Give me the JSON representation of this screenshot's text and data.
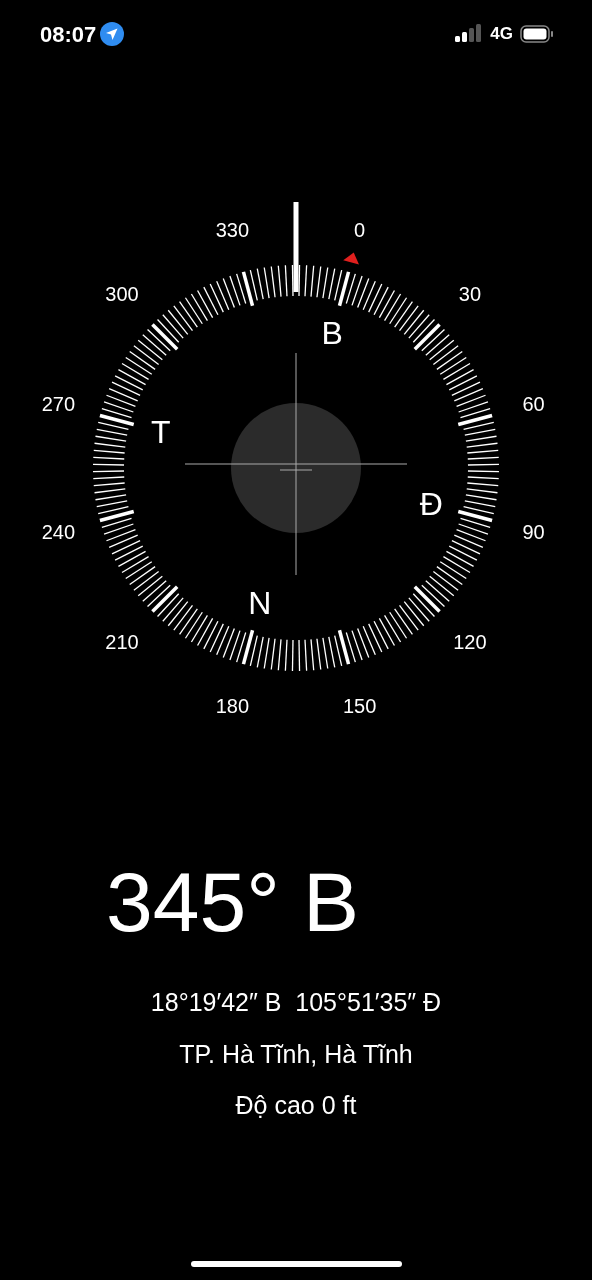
{
  "status_bar": {
    "time": "08:07",
    "network": "4G"
  },
  "compass": {
    "dial_labels": [
      "0",
      "30",
      "60",
      "90",
      "120",
      "150",
      "180",
      "210",
      "240",
      "270",
      "300",
      "330"
    ],
    "cardinals": [
      "B",
      "Đ",
      "N",
      "T"
    ]
  },
  "heading": "345° B",
  "coordinates": "18°19′42″ B  105°51′35″ Đ",
  "place": "TP. Hà Tĩnh, Hà Tĩnh",
  "altitude": "Độ cao 0 ft"
}
